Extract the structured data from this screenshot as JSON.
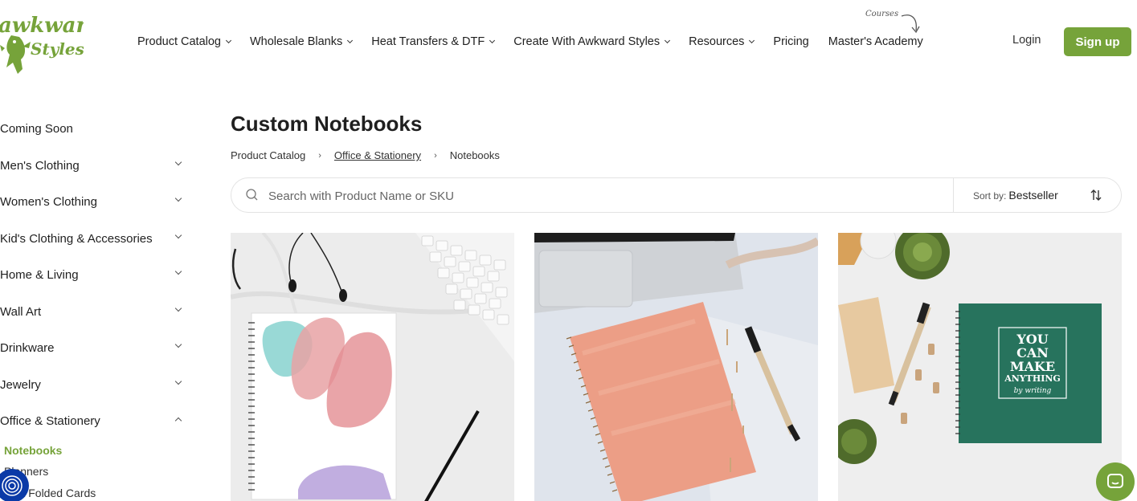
{
  "brand": {
    "name": "Awkward Styles",
    "logo_line1": "awkward",
    "logo_line2": "Styles",
    "accent": "#76a33a"
  },
  "header": {
    "nav": [
      {
        "label": "Product Catalog",
        "dropdown": true
      },
      {
        "label": "Wholesale Blanks",
        "dropdown": true
      },
      {
        "label": "Heat Transfers & DTF",
        "dropdown": true
      },
      {
        "label": "Create With Awkward Styles",
        "dropdown": true
      },
      {
        "label": "Resources",
        "dropdown": true
      },
      {
        "label": "Pricing",
        "dropdown": false
      },
      {
        "label": "Master's Academy",
        "dropdown": false
      }
    ],
    "courses_note": "Courses",
    "login": "Login",
    "signup": "Sign up"
  },
  "sidebar": {
    "categories": [
      {
        "label": "Coming Soon",
        "chevron": "none"
      },
      {
        "label": "Men's Clothing",
        "chevron": "down"
      },
      {
        "label": "Women's Clothing",
        "chevron": "down"
      },
      {
        "label": "Kid's Clothing & Accessories",
        "chevron": "down"
      },
      {
        "label": "Home & Living",
        "chevron": "down"
      },
      {
        "label": "Wall Art",
        "chevron": "down"
      },
      {
        "label": "Drinkware",
        "chevron": "down"
      },
      {
        "label": "Jewelry",
        "chevron": "down"
      },
      {
        "label": "Office & Stationery",
        "chevron": "up"
      }
    ],
    "subcategories": [
      {
        "label": "Notebooks",
        "active": true
      },
      {
        "label": "Planners",
        "active": false
      },
      {
        "label": "& Folded Cards",
        "active": false
      }
    ]
  },
  "main": {
    "title": "Custom Notebooks",
    "breadcrumb": [
      "Product Catalog",
      "Office & Stationery",
      "Notebooks"
    ],
    "search": {
      "placeholder": "Search with Product Name or SKU",
      "value": ""
    },
    "sort": {
      "label": "Sort by:",
      "value": "Bestseller"
    },
    "products": [
      {
        "image": "watercolor-spiral-notebook"
      },
      {
        "image": "peach-spiral-notebook"
      },
      {
        "image": "green-spiral-notebook",
        "cover_text": [
          "YOU",
          "CAN",
          "MAKE",
          "ANYTHING",
          "by writing"
        ]
      }
    ]
  }
}
